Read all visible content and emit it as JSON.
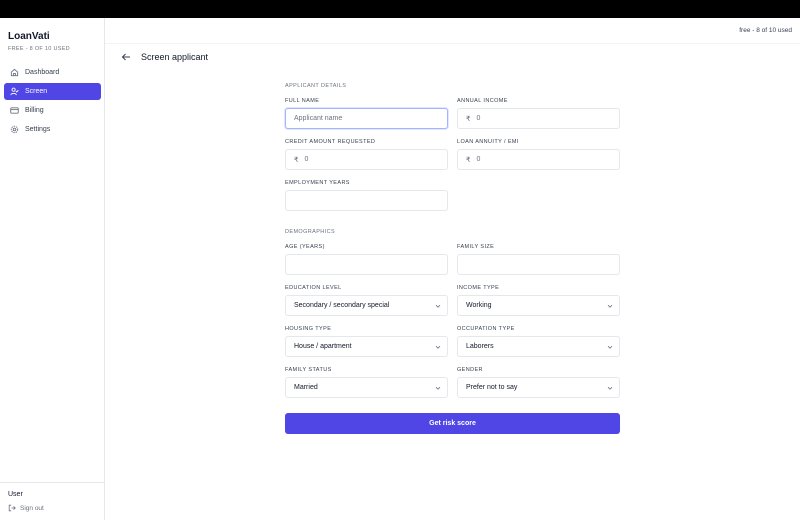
{
  "app": {
    "brand": "LoanVati",
    "plan_usage": "FREE - 8 OF 10 USED",
    "top_usage": "free - 8 of 10 used",
    "accent": "#4f46e5"
  },
  "sidebar": {
    "items": [
      {
        "label": "Dashboard",
        "icon": "home-icon",
        "active": false
      },
      {
        "label": "Screen",
        "icon": "user-check-icon",
        "active": true
      },
      {
        "label": "Billing",
        "icon": "credit-card-icon",
        "active": false
      },
      {
        "label": "Settings",
        "icon": "gear-icon",
        "active": false
      }
    ],
    "footer": {
      "user_label": "User",
      "signout_label": "Sign out"
    }
  },
  "page": {
    "title": "Screen applicant"
  },
  "form": {
    "applicant_section": "APPLICANT DETAILS",
    "demographics_section": "DEMOGRAPHICS",
    "full_name": {
      "label": "FULL NAME",
      "placeholder": "Applicant name",
      "value": ""
    },
    "annual_income": {
      "label": "ANNUAL INCOME",
      "currency": "₹",
      "placeholder": "0"
    },
    "credit_amount": {
      "label": "CREDIT AMOUNT REQUESTED",
      "currency": "₹",
      "placeholder": "0"
    },
    "loan_annuity": {
      "label": "LOAN ANNUITY / EMI",
      "currency": "₹",
      "placeholder": "0"
    },
    "employment_years": {
      "label": "EMPLOYMENT YEARS",
      "value": ""
    },
    "age": {
      "label": "AGE (YEARS)",
      "value": ""
    },
    "family_size": {
      "label": "FAMILY SIZE",
      "value": ""
    },
    "education_level": {
      "label": "EDUCATION LEVEL",
      "value": "Secondary / secondary special"
    },
    "income_type": {
      "label": "INCOME TYPE",
      "value": "Working"
    },
    "housing_type": {
      "label": "HOUSING TYPE",
      "value": "House / apartment"
    },
    "occupation_type": {
      "label": "OCCUPATION TYPE",
      "value": "Laborers"
    },
    "family_status": {
      "label": "FAMILY STATUS",
      "value": "Married"
    },
    "gender": {
      "label": "GENDER",
      "value": "Prefer not to say"
    },
    "submit_label": "Get risk score"
  }
}
